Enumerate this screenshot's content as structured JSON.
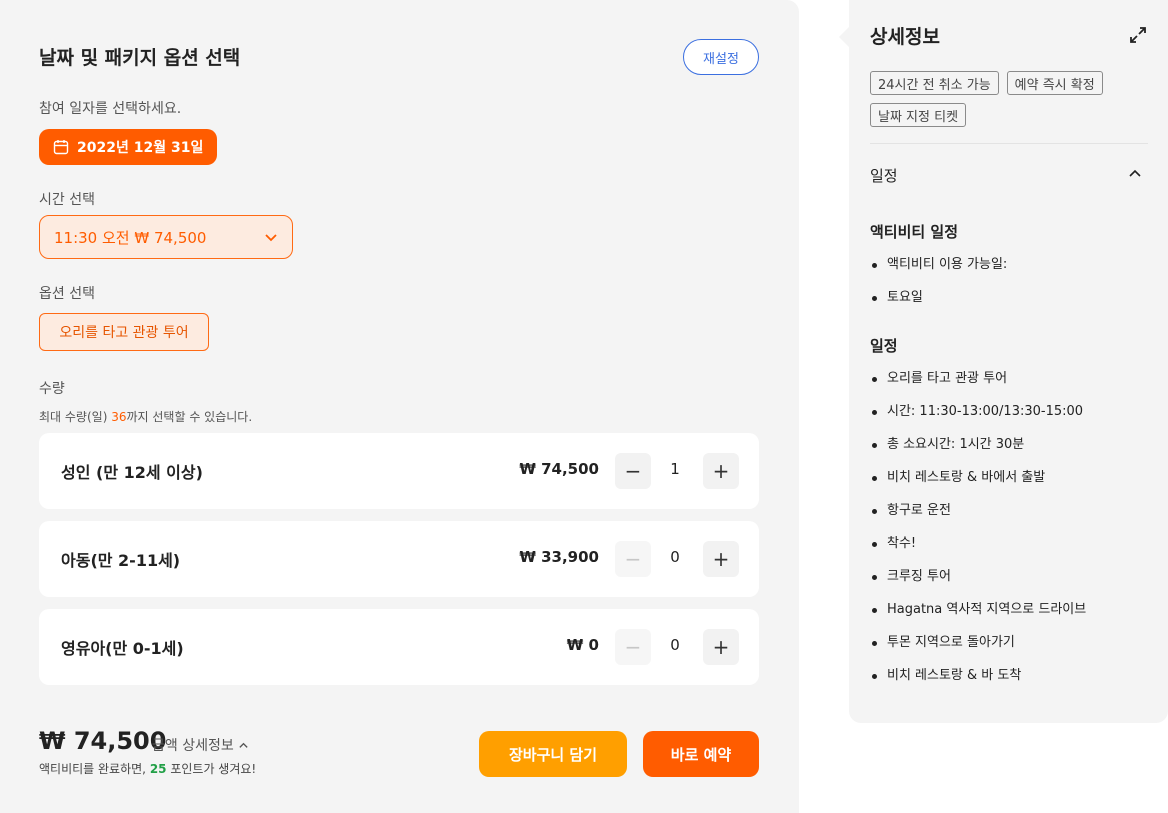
{
  "booking": {
    "title": "날짜 및 패키지 옵션 선택",
    "reset_label": "재설정",
    "date_prompt": "참여 일자를 선택하세요.",
    "selected_date": "2022년 12월 31일",
    "time_label": "시간 선택",
    "selected_time": "11:30 오전 ₩ 74,500",
    "option_label": "옵션 선택",
    "selected_option": "오리를 타고 관광 투어",
    "qty_label": "수량",
    "qty_note_prefix": "최대 수량(일) ",
    "qty_note_max": "36",
    "qty_note_suffix": "까지 선택할 수 있습니다.",
    "rows": [
      {
        "label": "성인 (만 12세 이상)",
        "price": "₩ 74,500",
        "count": "1",
        "minus_disabled": false
      },
      {
        "label": "아동(만 2-11세)",
        "price": "₩ 33,900",
        "count": "0",
        "minus_disabled": true
      },
      {
        "label": "영유아(만 0-1세)",
        "price": "₩ 0",
        "count": "0",
        "minus_disabled": true
      }
    ],
    "minus_symbol": "−",
    "plus_symbol": "+",
    "total_price": "₩ 74,500",
    "total_detail_label": "금액 상세정보",
    "points_prefix": "액티비티를 완료하면, ",
    "points_value": "25",
    "points_suffix": " 포인트가 생겨요!",
    "cart_label": "장바구니 담기",
    "book_label": "바로 예약"
  },
  "details": {
    "title": "상세정보",
    "tags": [
      "24시간 전 취소 가능",
      "예약 즉시 확정",
      "날짜 지정 티켓"
    ],
    "section_title": "일정",
    "activity_schedule_title": "액티비티 일정",
    "activity_schedule_items": [
      "액티비티 이용 가능일:",
      "토요일"
    ],
    "itinerary_title": "일정",
    "itinerary_items": [
      "오리를 타고 관광 투어",
      "시간: 11:30-13:00/13:30-15:00",
      "총 소요시간: 1시간 30분",
      "비치 레스토랑 & 바에서 출발",
      "항구로 운전",
      "착수!",
      "크루징 투어",
      "Hagatna 역사적 지역으로 드라이브",
      "투몬 지역으로 돌아가기",
      "비치 레스토랑 & 바 도착"
    ]
  },
  "colors": {
    "accent_orange": "#ff5c00",
    "cart_orange": "#ff9f00",
    "link_blue": "#3b6fe0",
    "points_green": "#22a047"
  },
  "icons": {
    "calendar": "calendar-icon",
    "chevron": "chevron-down-icon",
    "expand": "expand-icon",
    "collapse": "chevron-up-icon"
  }
}
